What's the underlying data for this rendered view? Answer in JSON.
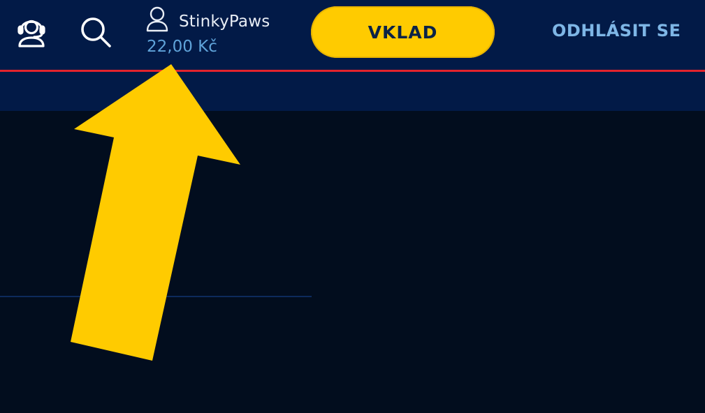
{
  "header": {
    "support_icon": "support-headset-icon",
    "search_icon": "search-icon",
    "user": {
      "icon": "user-icon",
      "username": "StinkyPaws",
      "balance": "22,00 Kč"
    },
    "deposit_label": "VKLAD",
    "logout_label": "ODHLÁSIT SE"
  },
  "annotation": {
    "arrow_icon": "arrow-up-icon",
    "arrow_color": "#ffcb00"
  },
  "colors": {
    "header_bg": "#021a47",
    "accent_red": "#e3232d",
    "page_bg": "#020d1e",
    "deposit_bg": "#ffcb00",
    "balance_text": "#5fa3d9",
    "logout_text": "#7eb6e6"
  }
}
